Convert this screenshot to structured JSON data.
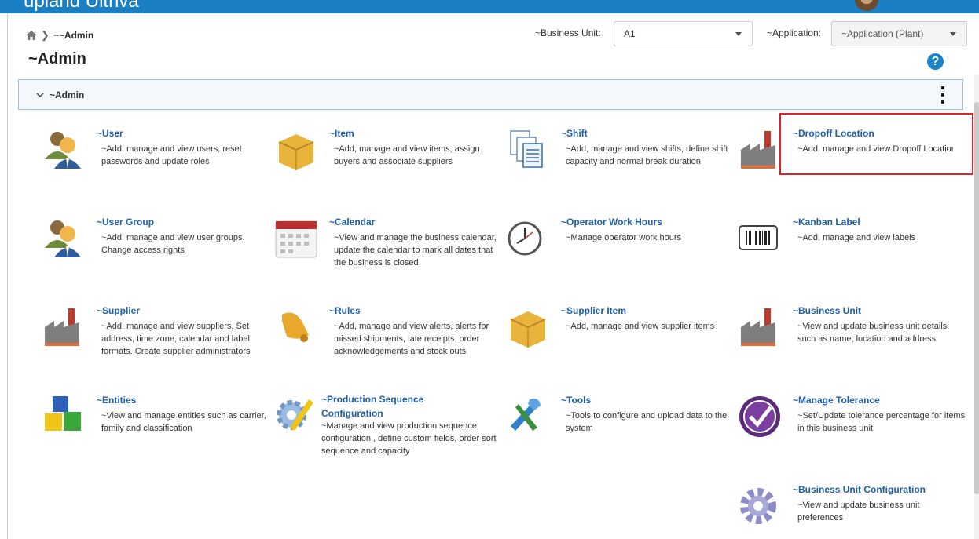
{
  "topbar": {
    "brand": "upland Ultriva"
  },
  "breadcrumb": {
    "current": "~~Admin"
  },
  "page": {
    "title": "~Admin"
  },
  "filters": {
    "business_unit_label": "~Business Unit:",
    "business_unit_value": "A1",
    "application_label": "~Application:",
    "application_value": "~Application (Plant)"
  },
  "help": {
    "glyph": "?"
  },
  "panel": {
    "title": "~Admin"
  },
  "tiles": [
    {
      "title": "~User",
      "desc": "~Add, manage and view users, reset passwords and update roles",
      "icon": "users-icon"
    },
    {
      "title": "~Item",
      "desc": "~Add, manage and view items, assign buyers and associate suppliers",
      "icon": "box-icon"
    },
    {
      "title": "~Shift",
      "desc": "~Add, manage and view shifts, define shift capacity and normal break duration",
      "icon": "documents-icon"
    },
    {
      "title": "~Dropoff Location",
      "desc": "~Add, manage and view Dropoff Locatior",
      "icon": "factory-icon"
    },
    {
      "title": "~User Group",
      "desc": "~Add, manage and view user groups. Change access rights",
      "icon": "users-icon"
    },
    {
      "title": "~Calendar",
      "desc": "~View and manage the business calendar, update the calendar to mark all dates that the business is closed",
      "icon": "calendar-icon"
    },
    {
      "title": "~Operator Work Hours",
      "desc": "~Manage operator work hours",
      "icon": "clock-icon"
    },
    {
      "title": "~Kanban Label",
      "desc": "~Add, manage and view labels",
      "icon": "barcode-icon"
    },
    {
      "title": "~Supplier",
      "desc": "~Add, manage and view suppliers. Set address, time zone, calendar and label formats. Create supplier administrators",
      "icon": "factory-icon"
    },
    {
      "title": "~Rules",
      "desc": "~Add, manage and view alerts, alerts for missed shipments, late receipts, order acknowledgements and stock outs",
      "icon": "bell-icon"
    },
    {
      "title": "~Supplier Item",
      "desc": "~Add, manage and view supplier items",
      "icon": "box-icon"
    },
    {
      "title": "~Business Unit",
      "desc": "~View and update business unit details such as name, location and address",
      "icon": "factory-icon"
    },
    {
      "title": "~Entities",
      "desc": "~View and manage entities such as carrier, family and classification",
      "icon": "cubes-icon"
    },
    {
      "title": "~Production Sequence Configuration",
      "desc": "~Manage and view production sequence configuration , define custom fields, order sort sequence and capacity",
      "icon": "gear-pencil-icon"
    },
    {
      "title": "~Tools",
      "desc": "~Tools to configure and upload data to the system",
      "icon": "tools-icon"
    },
    {
      "title": "~Manage Tolerance",
      "desc": "~Set/Update tolerance percentage for items in this business unit",
      "icon": "checkmark-badge-icon"
    },
    {
      "title": "~Business Unit Configuration",
      "desc": "~View and update business unit preferences",
      "icon": "gear-icon"
    }
  ]
}
